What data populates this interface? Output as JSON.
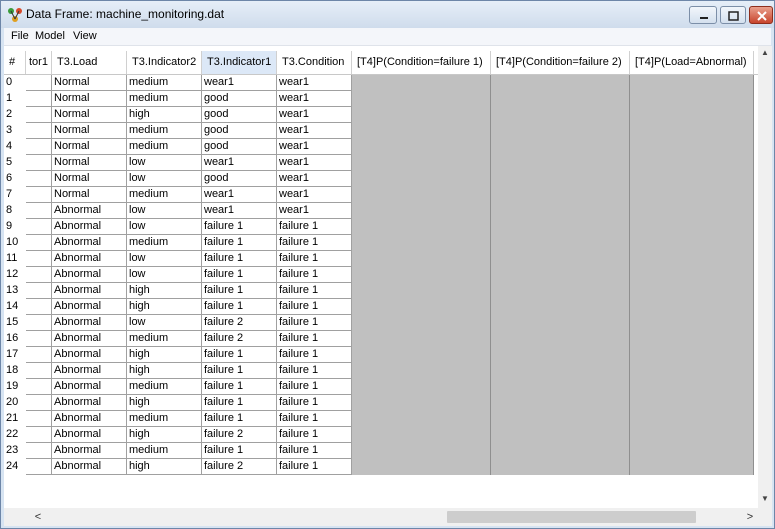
{
  "window": {
    "title": "Data Frame: machine_monitoring.dat"
  },
  "menu": [
    "File",
    "Model",
    "View"
  ],
  "columns": [
    "#",
    "tor1",
    "T3.Load",
    "T3.Indicator2",
    "T3.Indicator1",
    "T3.Condition",
    "[T4]P(Condition=failure 1)",
    "[T4]P(Condition=failure 2)",
    "[T4]P(Load=Abnormal)"
  ],
  "selected_column": "T3.Indicator1",
  "rows": [
    [
      "0",
      "",
      "Normal",
      "medium",
      "wear1",
      "wear1"
    ],
    [
      "1",
      "",
      "Normal",
      "medium",
      "good",
      "wear1"
    ],
    [
      "2",
      "",
      "Normal",
      "high",
      "good",
      "wear1"
    ],
    [
      "3",
      "",
      "Normal",
      "medium",
      "good",
      "wear1"
    ],
    [
      "4",
      "",
      "Normal",
      "medium",
      "good",
      "wear1"
    ],
    [
      "5",
      "",
      "Normal",
      "low",
      "wear1",
      "wear1"
    ],
    [
      "6",
      "",
      "Normal",
      "low",
      "good",
      "wear1"
    ],
    [
      "7",
      "",
      "Normal",
      "medium",
      "wear1",
      "wear1"
    ],
    [
      "8",
      "",
      "Abnormal",
      "low",
      "wear1",
      "wear1"
    ],
    [
      "9",
      "",
      "Abnormal",
      "low",
      "failure 1",
      "failure 1"
    ],
    [
      "10",
      "",
      "Abnormal",
      "medium",
      "failure 1",
      "failure 1"
    ],
    [
      "11",
      "",
      "Abnormal",
      "low",
      "failure 1",
      "failure 1"
    ],
    [
      "12",
      "",
      "Abnormal",
      "low",
      "failure 1",
      "failure 1"
    ],
    [
      "13",
      "",
      "Abnormal",
      "high",
      "failure 1",
      "failure 1"
    ],
    [
      "14",
      "",
      "Abnormal",
      "high",
      "failure 1",
      "failure 1"
    ],
    [
      "15",
      "",
      "Abnormal",
      "low",
      "failure 2",
      "failure 1"
    ],
    [
      "16",
      "",
      "Abnormal",
      "medium",
      "failure 2",
      "failure 1"
    ],
    [
      "17",
      "",
      "Abnormal",
      "high",
      "failure 1",
      "failure 1"
    ],
    [
      "18",
      "",
      "Abnormal",
      "high",
      "failure 1",
      "failure 1"
    ],
    [
      "19",
      "",
      "Abnormal",
      "medium",
      "failure 1",
      "failure 1"
    ],
    [
      "20",
      "",
      "Abnormal",
      "high",
      "failure 1",
      "failure 1"
    ],
    [
      "21",
      "",
      "Abnormal",
      "medium",
      "failure 1",
      "failure 1"
    ],
    [
      "22",
      "",
      "Abnormal",
      "high",
      "failure 2",
      "failure 1"
    ],
    [
      "23",
      "",
      "Abnormal",
      "medium",
      "failure 1",
      "failure 1"
    ],
    [
      "24",
      "",
      "Abnormal",
      "high",
      "failure 2",
      "failure 1"
    ]
  ],
  "colors": {
    "titlebar": "#d7e4f2",
    "empty_cell": "#c0c0c0",
    "selected_header": "#dce8f7"
  },
  "icons": {
    "app": "network-app-icon",
    "minimize": "minimize-icon",
    "maximize": "maximize-icon",
    "close": "close-icon"
  }
}
